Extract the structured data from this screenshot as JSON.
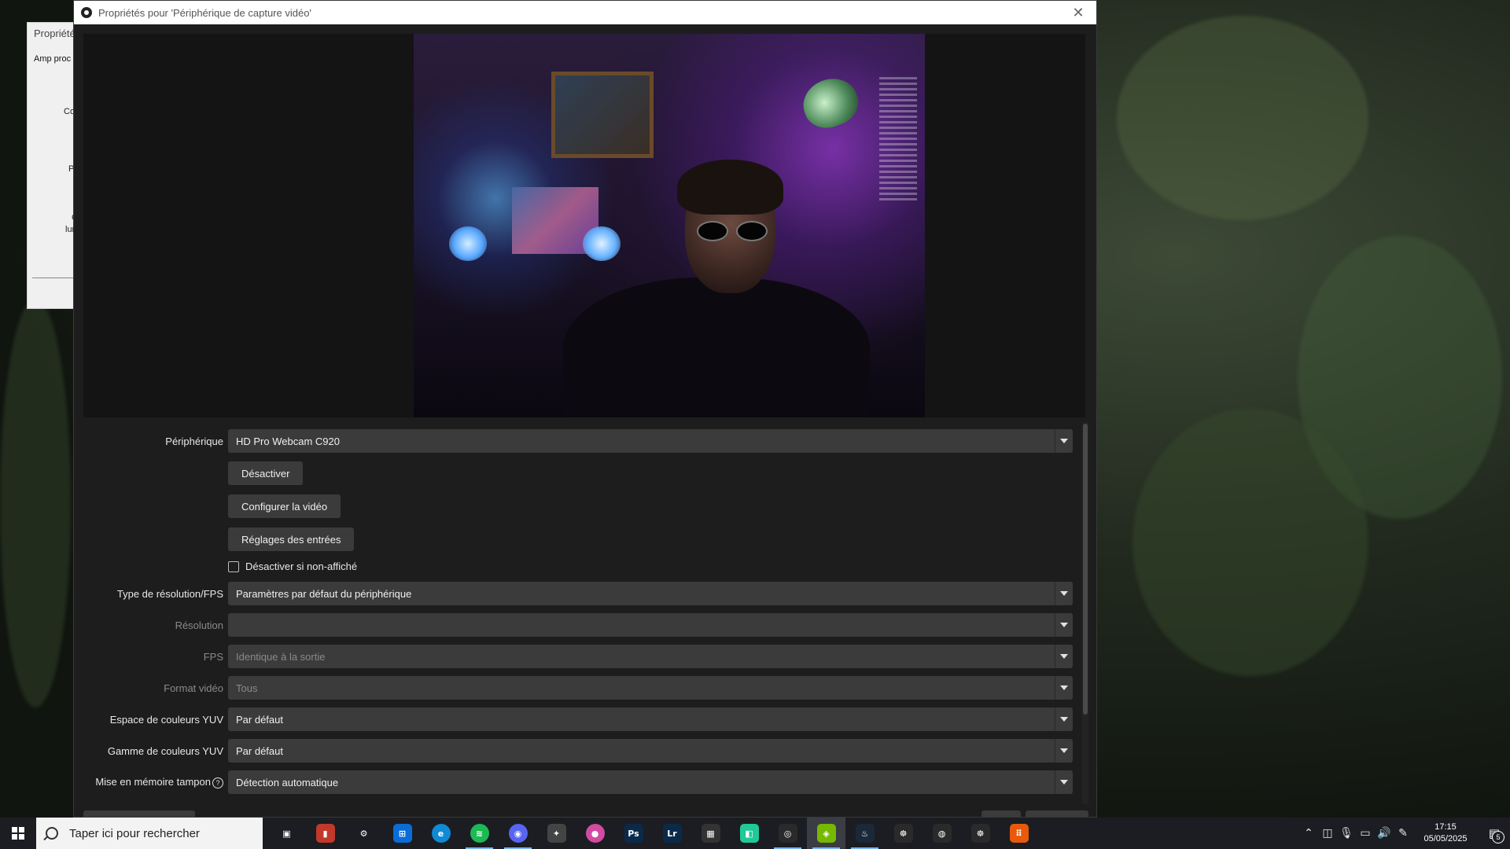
{
  "background_window": {
    "title": "Propriétés",
    "tab": "Amp proc",
    "labels": [
      "Co",
      "P",
      "C",
      "lum"
    ]
  },
  "dialog": {
    "title": "Propriétés pour 'Périphérique de capture vidéo'",
    "close_icon": "close-icon"
  },
  "properties": {
    "device": {
      "label": "Périphérique",
      "value": "HD Pro Webcam C920"
    },
    "deactivate_button": "Désactiver",
    "configure_video_button": "Configurer la vidéo",
    "input_settings_button": "Réglages des entrées",
    "deactivate_hidden_checkbox": {
      "label": "Désactiver si non-affiché",
      "checked": false
    },
    "resolution_fps_type": {
      "label": "Type de résolution/FPS",
      "value": "Paramètres par défaut du périphérique"
    },
    "resolution": {
      "label": "Résolution",
      "value": ""
    },
    "fps": {
      "label": "FPS",
      "value": "Identique à la sortie"
    },
    "video_format": {
      "label": "Format vidéo",
      "value": "Tous"
    },
    "yuv_color_space": {
      "label": "Espace de couleurs YUV",
      "value": "Par défaut"
    },
    "yuv_color_range": {
      "label": "Gamme de couleurs YUV",
      "value": "Par défaut"
    },
    "buffering": {
      "label": "Mise en mémoire tampon",
      "value": "Détection automatique"
    }
  },
  "taskbar": {
    "search_placeholder": "Taper ici pour rechercher",
    "apps": [
      {
        "name": "task-view-icon",
        "glyph": "▣",
        "color": "#1b1d22"
      },
      {
        "name": "media-app-icon",
        "glyph": "▮",
        "color": "#c0392b"
      },
      {
        "name": "settings-icon",
        "glyph": "⚙",
        "color": "#1b1d22"
      },
      {
        "name": "store-icon",
        "glyph": "⊞",
        "color": "#0a6cd6"
      },
      {
        "name": "edge-icon",
        "glyph": "e",
        "color": "#0f8ad6"
      },
      {
        "name": "spotify-icon",
        "glyph": "≋",
        "color": "#1db954"
      },
      {
        "name": "discord-icon",
        "glyph": "◉",
        "color": "#5865f2"
      },
      {
        "name": "davinci-icon",
        "glyph": "✦",
        "color": "#444"
      },
      {
        "name": "color-app-icon",
        "glyph": "●",
        "color": "#d14ca0"
      },
      {
        "name": "photoshop-icon",
        "glyph": "Ps",
        "color": "#0b2a4a"
      },
      {
        "name": "lightroom-icon",
        "glyph": "Lr",
        "color": "#0b2a4a"
      },
      {
        "name": "keyboard-app-icon",
        "glyph": "▦",
        "color": "#333"
      },
      {
        "name": "android-app-icon",
        "glyph": "◧",
        "color": "#20c997"
      },
      {
        "name": "obs-icon",
        "glyph": "◎",
        "color": "#2a2a2a"
      },
      {
        "name": "nvidia-icon",
        "glyph": "◈",
        "color": "#76b900"
      },
      {
        "name": "steam-icon",
        "glyph": "♨",
        "color": "#1b2838"
      },
      {
        "name": "razer-icon",
        "glyph": "☸",
        "color": "#2a2a2a"
      },
      {
        "name": "ring-app-icon",
        "glyph": "◍",
        "color": "#2a2a2a"
      },
      {
        "name": "razer-synapse-icon",
        "glyph": "☸",
        "color": "#2a2a2a"
      },
      {
        "name": "orange-app-icon",
        "glyph": "⠿",
        "color": "#e8590c"
      }
    ],
    "clock_time": "17:15",
    "clock_date": "05/05/2025",
    "notification_count": "5"
  }
}
